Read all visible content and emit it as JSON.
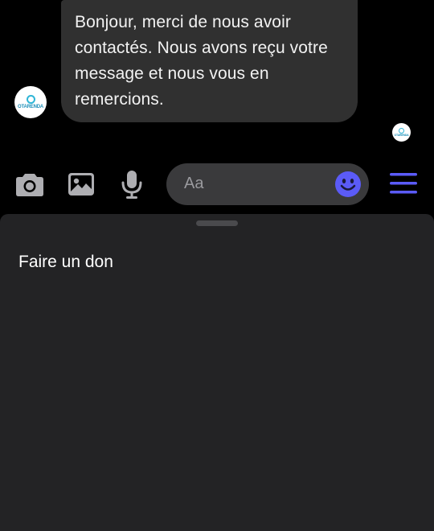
{
  "message": {
    "text": "Bonjour, merci de nous avoir contactés. Nous avons reçu votre message et nous vous en remercions.",
    "sender_avatar_brand": "OTARENDA",
    "read_receipt_avatar_brand": "OTARENDA"
  },
  "composer": {
    "camera_icon": "camera-icon",
    "gallery_icon": "image-icon",
    "mic_icon": "microphone-icon",
    "input_placeholder": "Aa",
    "emoji_icon": "smiley-icon",
    "menu_icon": "hamburger-menu-icon"
  },
  "sheet": {
    "items": [
      {
        "label": "Faire un don"
      }
    ]
  },
  "colors": {
    "accent": "#5b5bf7",
    "bubble": "#303030",
    "sheet_bg": "#232325",
    "input_bg": "#3a3a3c",
    "brand": "#2fb5d6"
  }
}
